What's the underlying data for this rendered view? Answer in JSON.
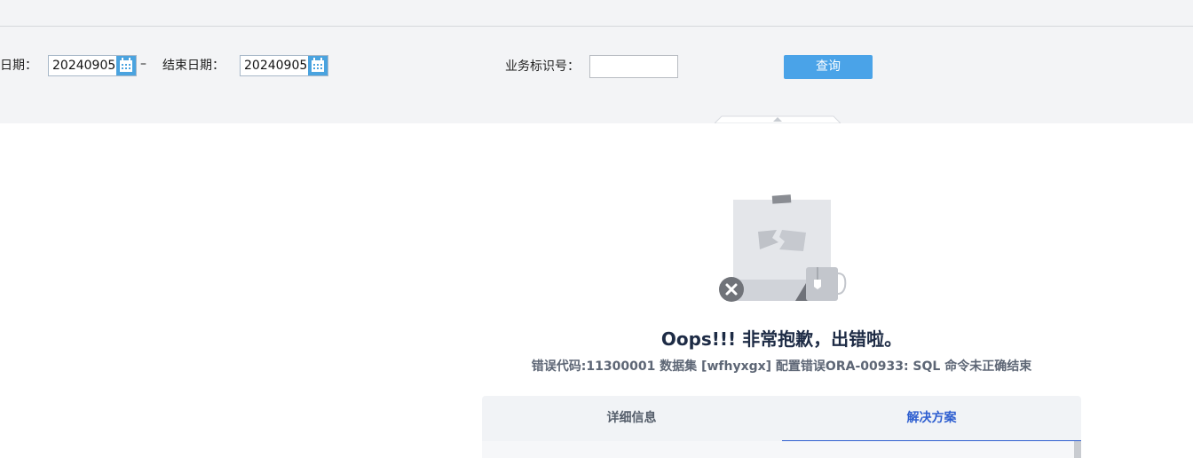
{
  "filters": {
    "start_date_label": "日期：",
    "start_date_value": "20240905",
    "separator": "–",
    "end_date_label": "结束日期：",
    "end_date_value": "20240905",
    "business_id_label": "业务标识号：",
    "business_id_value": "",
    "query_button": "查询",
    "calendar_icon": "calendar-icon"
  },
  "error": {
    "title": "Oops!!! 非常抱歉，出错啦。",
    "message": "错误代码:11300001 数据集 [wfhyxgx] 配置错误ORA-00933: SQL 命令未正确结束",
    "illustration_icon": "broken-page-illustration",
    "error_icon": "close-circle-icon",
    "tabs": [
      {
        "label": "详细信息",
        "active": false
      },
      {
        "label": "解决方案",
        "active": true
      }
    ]
  },
  "colors": {
    "accent": "#4aa3e8",
    "active_tab": "#2f5fd0",
    "title": "#1d2b45"
  }
}
